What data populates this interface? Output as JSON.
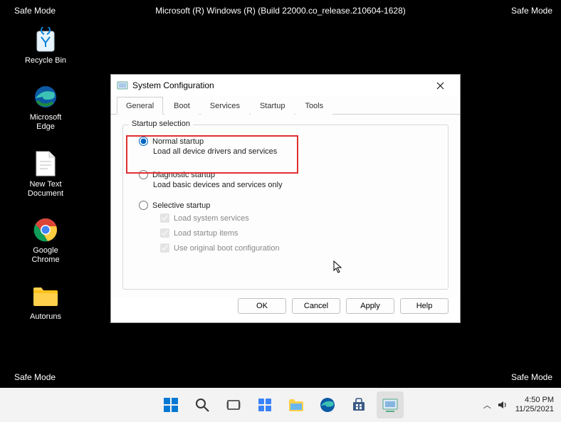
{
  "safe_mode_label": "Safe Mode",
  "build_text": "Microsoft (R) Windows (R) (Build 22000.co_release.210604-1628)",
  "desktop": {
    "icons": [
      {
        "label": "Recycle Bin",
        "icon": "recycle-bin-icon"
      },
      {
        "label": "Microsoft Edge",
        "icon": "edge-icon"
      },
      {
        "label": "New Text Document",
        "icon": "text-file-icon"
      },
      {
        "label": "Google Chrome",
        "icon": "chrome-icon"
      },
      {
        "label": "Autoruns",
        "icon": "folder-icon"
      }
    ]
  },
  "dialog": {
    "title": "System Configuration",
    "tabs": [
      "General",
      "Boot",
      "Services",
      "Startup",
      "Tools"
    ],
    "active_tab": 0,
    "fieldset_legend": "Startup selection",
    "options": {
      "normal": {
        "label": "Normal startup",
        "desc": "Load all device drivers and services",
        "selected": true
      },
      "diagnostic": {
        "label": "Diagnostic startup",
        "desc": "Load basic devices and services only",
        "selected": false
      },
      "selective": {
        "label": "Selective startup",
        "selected": false,
        "checks": [
          {
            "label": "Load system services",
            "checked": true,
            "disabled": true
          },
          {
            "label": "Load startup items",
            "checked": true,
            "disabled": true
          },
          {
            "label": "Use original boot configuration",
            "checked": true,
            "disabled": true
          }
        ]
      }
    },
    "buttons": {
      "ok": "OK",
      "cancel": "Cancel",
      "apply": "Apply",
      "help": "Help"
    }
  },
  "taskbar": {
    "items": [
      "start",
      "search",
      "taskview",
      "widgets",
      "explorer",
      "edge",
      "store",
      "msconfig"
    ],
    "tray": {
      "chevron": "^",
      "sound": "sound-icon"
    },
    "clock": {
      "time": "4:50 PM",
      "date": "11/25/2021"
    }
  }
}
